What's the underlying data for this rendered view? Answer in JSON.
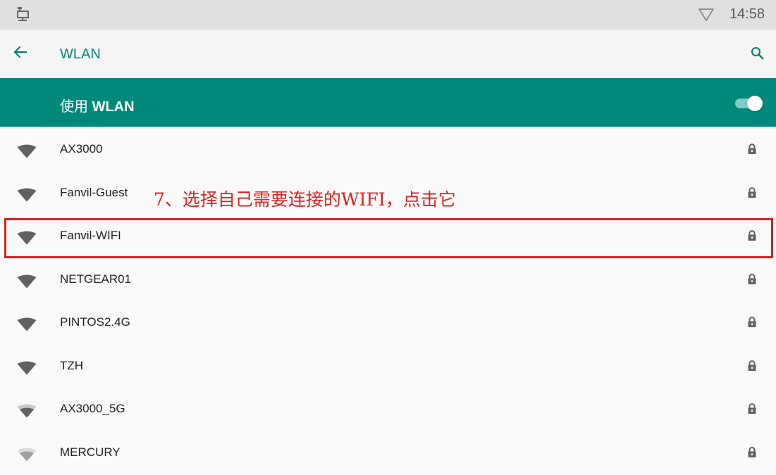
{
  "status_bar": {
    "time": "14:58",
    "left_icon": "ethernet-icon",
    "right_icon": "wifi-outline-icon"
  },
  "toolbar": {
    "title": "WLAN",
    "back_icon": "arrow-left-icon",
    "search_icon": "search-icon"
  },
  "wlan_switch": {
    "label_cn": "使用",
    "label_en": "WLAN",
    "enabled": true
  },
  "networks": [
    {
      "ssid": "AX3000",
      "secured": true,
      "strength": "strong"
    },
    {
      "ssid": "Fanvil-Guest",
      "secured": true,
      "strength": "strong"
    },
    {
      "ssid": "Fanvil-WIFI",
      "secured": true,
      "strength": "strong",
      "highlighted": true
    },
    {
      "ssid": "NETGEAR01",
      "secured": true,
      "strength": "strong"
    },
    {
      "ssid": "PINTOS2.4G",
      "secured": true,
      "strength": "strong"
    },
    {
      "ssid": "TZH",
      "secured": true,
      "strength": "strong"
    },
    {
      "ssid": "AX3000_5G",
      "secured": true,
      "strength": "medium"
    },
    {
      "ssid": "MERCURY",
      "secured": true,
      "strength": "weak"
    }
  ],
  "annotation": {
    "text": "7、选择自己需要连接的WIFI，点击它"
  },
  "colors": {
    "accent": "#00897b",
    "annotation_red": "#e01f1f"
  }
}
